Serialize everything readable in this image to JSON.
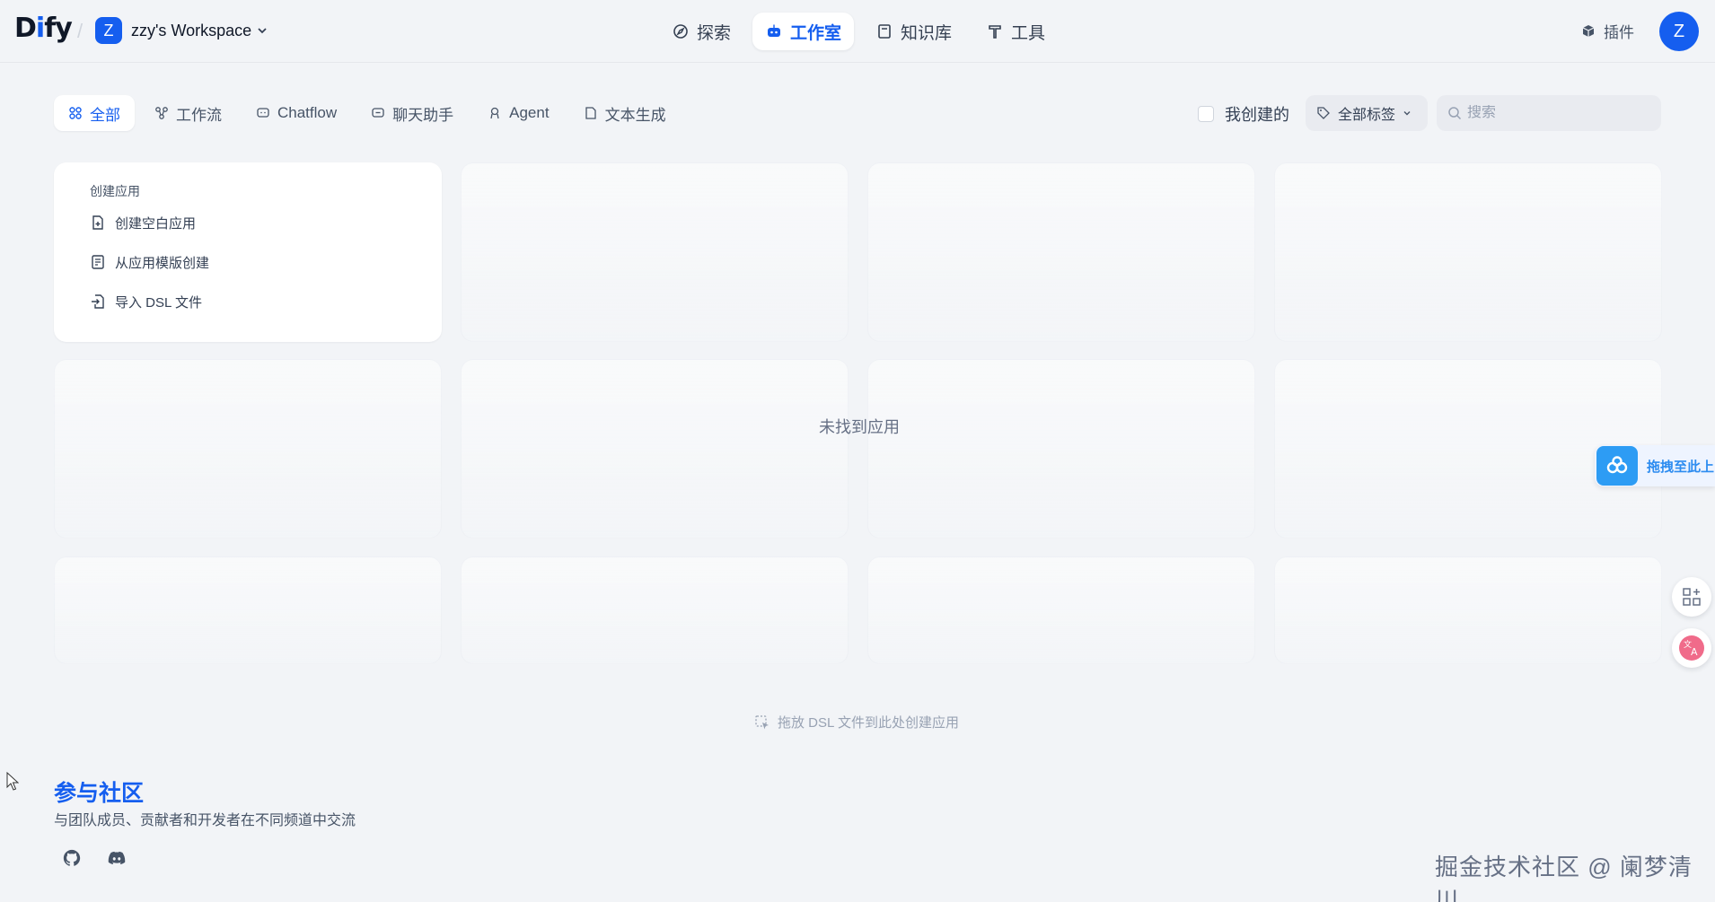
{
  "header": {
    "logo_text": "Dify",
    "workspace": {
      "badge": "Z",
      "name": "zzy's Workspace"
    },
    "nav": [
      {
        "label": "探索",
        "icon": "compass-icon",
        "active": false
      },
      {
        "label": "工作室",
        "icon": "robot-icon",
        "active": true
      },
      {
        "label": "知识库",
        "icon": "book-icon",
        "active": false
      },
      {
        "label": "工具",
        "icon": "hammer-icon",
        "active": false
      }
    ],
    "plugin_label": "插件",
    "avatar_letter": "Z"
  },
  "filters": {
    "tabs": [
      {
        "label": "全部",
        "icon": "grid-icon",
        "active": true
      },
      {
        "label": "工作流",
        "icon": "workflow-icon",
        "active": false
      },
      {
        "label": "Chatflow",
        "icon": "chat-bubble-icon",
        "active": false
      },
      {
        "label": "聊天助手",
        "icon": "chat-bubble-icon",
        "active": false
      },
      {
        "label": "Agent",
        "icon": "agent-icon",
        "active": false
      },
      {
        "label": "文本生成",
        "icon": "file-text-icon",
        "active": false
      }
    ],
    "mine_label": "我创建的",
    "mine_checked": false,
    "tags_label": "全部标签",
    "search_placeholder": "搜索"
  },
  "create_card": {
    "title": "创建应用",
    "items": [
      {
        "label": "创建空白应用",
        "icon": "file-plus-icon"
      },
      {
        "label": "从应用模版创建",
        "icon": "template-icon"
      },
      {
        "label": "导入 DSL 文件",
        "icon": "file-import-icon"
      }
    ]
  },
  "empty_text": "未找到应用",
  "drop_hint": "拖放 DSL 文件到此处创建应用",
  "community": {
    "title": "参与社区",
    "subtitle": "与团队成员、贡献者和开发者在不同频道中交流",
    "links": [
      "github-icon",
      "discord-icon"
    ]
  },
  "floating": {
    "upload_label": "拖拽至此上"
  },
  "watermark": "掘金技术社区 @ 阑梦清川",
  "colors": {
    "accent": "#155eef",
    "background": "#f2f4f7"
  }
}
